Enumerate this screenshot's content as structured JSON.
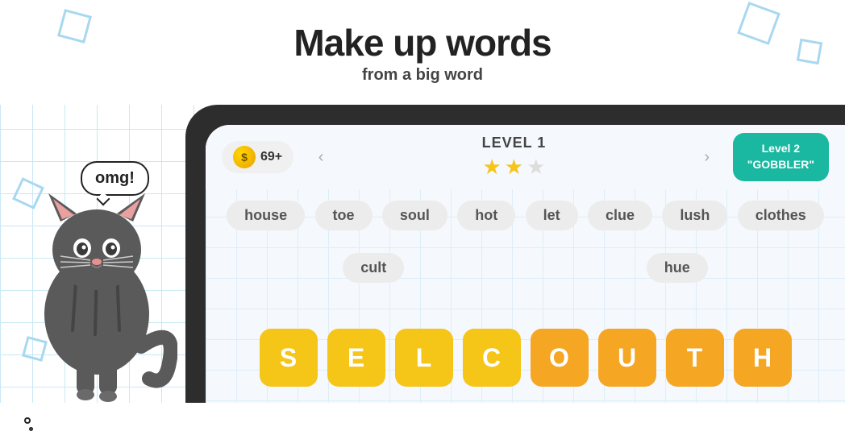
{
  "header": {
    "title": "Make up words",
    "subtitle": "from a big word"
  },
  "game": {
    "coins": "69+",
    "level_label": "LEVEL 1",
    "stars": [
      true,
      true,
      false
    ],
    "nav_left": "‹",
    "nav_right": "›",
    "next_level_line1": "Level 2",
    "next_level_line2": "\"GOBBLER\""
  },
  "words": [
    "house",
    "toe",
    "soul",
    "hot",
    "let",
    "clue",
    "lush",
    "clothes",
    "cult",
    "hue"
  ],
  "tiles": [
    {
      "letter": "S",
      "style": "yellow"
    },
    {
      "letter": "E",
      "style": "yellow"
    },
    {
      "letter": "L",
      "style": "yellow"
    },
    {
      "letter": "C",
      "style": "yellow"
    },
    {
      "letter": "O",
      "style": "orange"
    },
    {
      "letter": "U",
      "style": "orange"
    },
    {
      "letter": "T",
      "style": "orange"
    },
    {
      "letter": "H",
      "style": "orange"
    }
  ],
  "speech": "omg!",
  "colors": {
    "accent_teal": "#1ab8a0",
    "tile_yellow": "#f5c518",
    "tile_orange": "#f5a623"
  }
}
